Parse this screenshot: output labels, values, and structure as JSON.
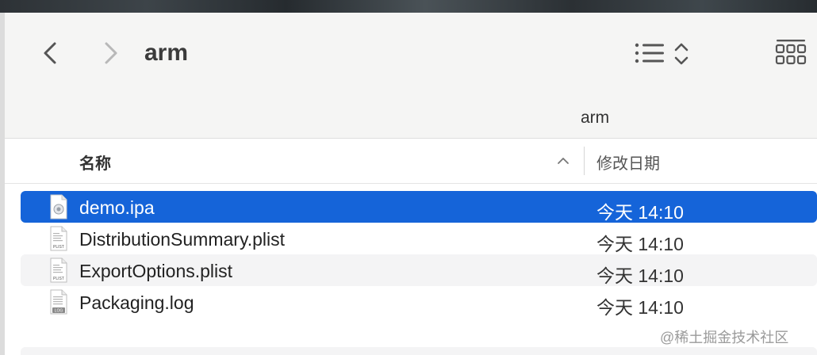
{
  "window": {
    "title": "arm",
    "path_label": "arm"
  },
  "toolbar": {
    "back_icon": "chevron-left-icon",
    "forward_icon": "chevron-right-icon",
    "view_icon": "list-view-icon",
    "sort_toggle_icon": "chevron-updown-icon",
    "group_icon": "grid-view-icon"
  },
  "columns": {
    "name": "名称",
    "date": "修改日期",
    "sort_icon": "chevron-up-icon"
  },
  "files": [
    {
      "name": "demo.ipa",
      "date": "今天 14:10",
      "icon": "ipa-file-icon",
      "selected": true
    },
    {
      "name": "DistributionSummary.plist",
      "date": "今天 14:10",
      "icon": "plist-file-icon",
      "selected": false,
      "icon_label": "PLIST"
    },
    {
      "name": "ExportOptions.plist",
      "date": "今天 14:10",
      "icon": "plist-file-icon",
      "selected": false,
      "icon_label": "PLIST"
    },
    {
      "name": "Packaging.log",
      "date": "今天 14:10",
      "icon": "log-file-icon",
      "selected": false,
      "icon_label": "LOG"
    }
  ],
  "watermark": "@稀土掘金技术社区",
  "colors": {
    "selection": "#1564d9",
    "alt_row": "#f4f4f5",
    "toolbar_bg": "#f5f5f4"
  }
}
